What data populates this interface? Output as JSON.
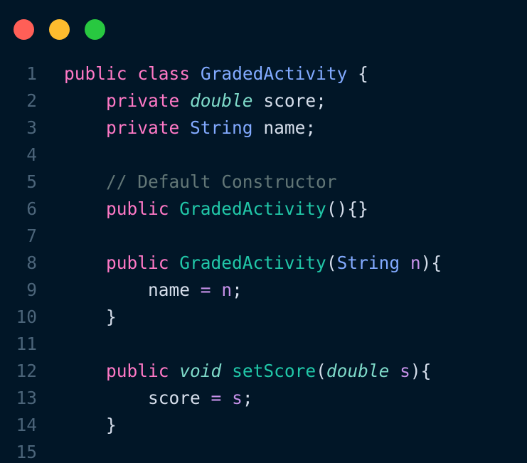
{
  "window": {
    "controls": [
      {
        "name": "close",
        "color": "#ff5f57"
      },
      {
        "name": "minimize",
        "color": "#febc2e"
      },
      {
        "name": "maximize",
        "color": "#28c840"
      }
    ]
  },
  "editor": {
    "lines": [
      {
        "number": "1",
        "tokens": [
          {
            "t": "public",
            "c": "kw"
          },
          {
            "t": " ",
            "c": "pn"
          },
          {
            "t": "class",
            "c": "kw"
          },
          {
            "t": " ",
            "c": "pn"
          },
          {
            "t": "GradedActivity",
            "c": "cls"
          },
          {
            "t": " {",
            "c": "pn"
          }
        ]
      },
      {
        "number": "2",
        "tokens": [
          {
            "t": "    ",
            "c": "pn"
          },
          {
            "t": "private",
            "c": "kw"
          },
          {
            "t": " ",
            "c": "pn"
          },
          {
            "t": "double",
            "c": "ity"
          },
          {
            "t": " score;",
            "c": "var"
          }
        ]
      },
      {
        "number": "3",
        "tokens": [
          {
            "t": "    ",
            "c": "pn"
          },
          {
            "t": "private",
            "c": "kw"
          },
          {
            "t": " ",
            "c": "pn"
          },
          {
            "t": "String",
            "c": "ty"
          },
          {
            "t": " name;",
            "c": "var"
          }
        ]
      },
      {
        "number": "4",
        "tokens": []
      },
      {
        "number": "5",
        "tokens": [
          {
            "t": "    ",
            "c": "pn"
          },
          {
            "t": "// Default Constructor",
            "c": "cm"
          }
        ]
      },
      {
        "number": "6",
        "tokens": [
          {
            "t": "    ",
            "c": "pn"
          },
          {
            "t": "public",
            "c": "kw"
          },
          {
            "t": " ",
            "c": "pn"
          },
          {
            "t": "GradedActivity",
            "c": "fn"
          },
          {
            "t": "(){}",
            "c": "par"
          }
        ]
      },
      {
        "number": "7",
        "tokens": []
      },
      {
        "number": "8",
        "tokens": [
          {
            "t": "    ",
            "c": "pn"
          },
          {
            "t": "public",
            "c": "kw"
          },
          {
            "t": " ",
            "c": "pn"
          },
          {
            "t": "GradedActivity",
            "c": "fn"
          },
          {
            "t": "(",
            "c": "par"
          },
          {
            "t": "String",
            "c": "ty"
          },
          {
            "t": " ",
            "c": "pn"
          },
          {
            "t": "n",
            "c": "arg"
          },
          {
            "t": "){",
            "c": "par"
          }
        ]
      },
      {
        "number": "9",
        "tokens": [
          {
            "t": "        ",
            "c": "pn"
          },
          {
            "t": "name",
            "c": "var"
          },
          {
            "t": " ",
            "c": "pn"
          },
          {
            "t": "=",
            "c": "op"
          },
          {
            "t": " ",
            "c": "pn"
          },
          {
            "t": "n",
            "c": "arg"
          },
          {
            "t": ";",
            "c": "pn"
          }
        ]
      },
      {
        "number": "10",
        "tokens": [
          {
            "t": "    }",
            "c": "pn"
          }
        ]
      },
      {
        "number": "11",
        "tokens": []
      },
      {
        "number": "12",
        "tokens": [
          {
            "t": "    ",
            "c": "pn"
          },
          {
            "t": "public",
            "c": "kw"
          },
          {
            "t": " ",
            "c": "pn"
          },
          {
            "t": "void",
            "c": "ity"
          },
          {
            "t": " ",
            "c": "pn"
          },
          {
            "t": "setScore",
            "c": "fn"
          },
          {
            "t": "(",
            "c": "par"
          },
          {
            "t": "double",
            "c": "ity"
          },
          {
            "t": " ",
            "c": "pn"
          },
          {
            "t": "s",
            "c": "arg"
          },
          {
            "t": "){",
            "c": "par"
          }
        ]
      },
      {
        "number": "13",
        "tokens": [
          {
            "t": "        ",
            "c": "pn"
          },
          {
            "t": "score",
            "c": "var"
          },
          {
            "t": " ",
            "c": "pn"
          },
          {
            "t": "=",
            "c": "op"
          },
          {
            "t": " ",
            "c": "pn"
          },
          {
            "t": "s",
            "c": "arg"
          },
          {
            "t": ";",
            "c": "pn"
          }
        ]
      },
      {
        "number": "14",
        "tokens": [
          {
            "t": "    }",
            "c": "pn"
          }
        ]
      },
      {
        "number": "15",
        "tokens": []
      }
    ]
  }
}
